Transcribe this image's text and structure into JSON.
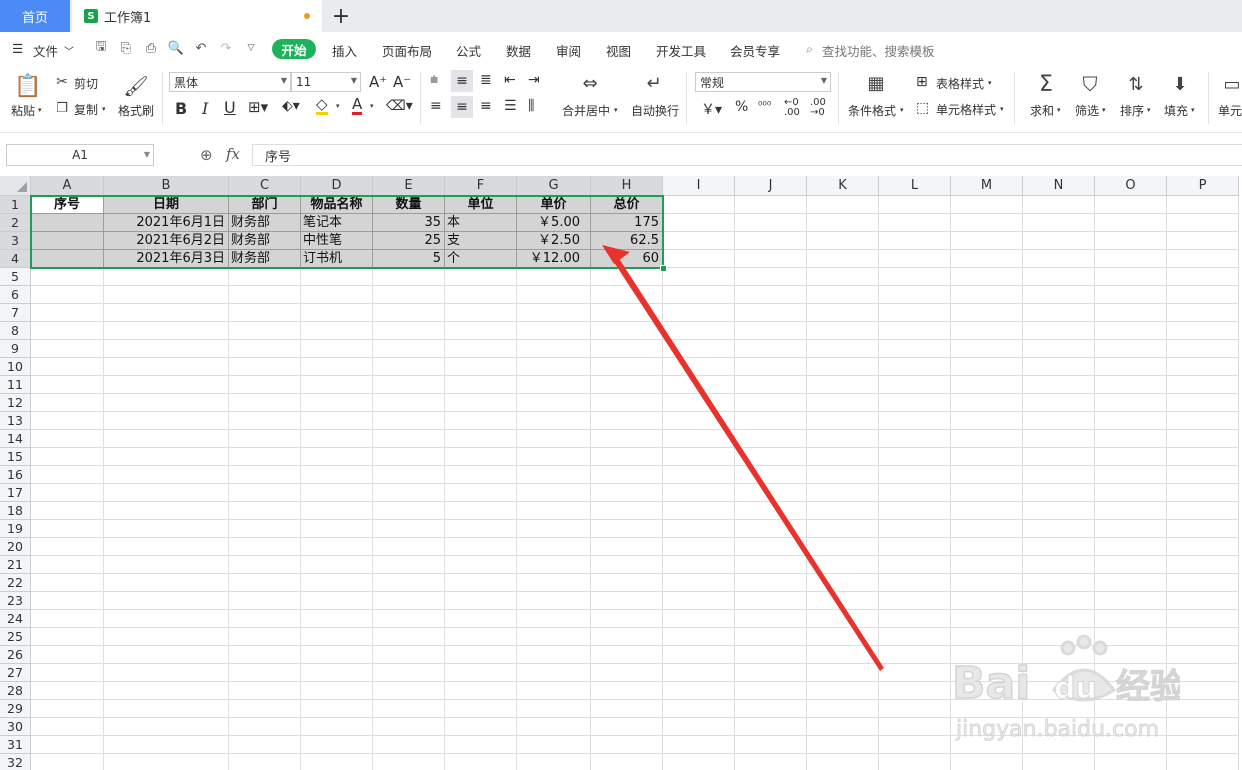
{
  "tabs": {
    "home": "首页",
    "doc": "工作簿1",
    "doc_icon": "S",
    "new_tab": "+"
  },
  "menu": {
    "file": "文件",
    "items": [
      "开始",
      "插入",
      "页面布局",
      "公式",
      "数据",
      "审阅",
      "视图",
      "开发工具",
      "会员专享"
    ],
    "search": "查找功能、搜索模板"
  },
  "ribbon": {
    "paste": "粘贴",
    "cut": "剪切",
    "copy": "复制",
    "format_painter": "格式刷",
    "font": "黑体",
    "size": "11",
    "merge": "合并居中",
    "wrap": "自动换行",
    "number_format": "常规",
    "cond_format": "条件格式",
    "table_style": "表格样式",
    "cell_style": "单元格样式",
    "sum": "求和",
    "filter": "筛选",
    "sort": "排序",
    "fill": "填充",
    "cell": "单元"
  },
  "formula_bar": {
    "name_box": "A1",
    "fx": "fx",
    "content": "序号"
  },
  "columns": [
    "A",
    "B",
    "C",
    "D",
    "E",
    "F",
    "G",
    "H",
    "I",
    "J",
    "K",
    "L",
    "M",
    "N",
    "O",
    "P"
  ],
  "rows": [
    "1",
    "2",
    "3",
    "4",
    "5",
    "6",
    "7",
    "8",
    "9",
    "10",
    "11",
    "12",
    "13",
    "14",
    "15",
    "16",
    "17",
    "18",
    "19",
    "20",
    "21",
    "22",
    "23",
    "24",
    "25",
    "26",
    "27",
    "28",
    "29",
    "30",
    "31",
    "32"
  ],
  "table": {
    "header": [
      "序号",
      "日期",
      "部门",
      "物品名称",
      "数量",
      "单位",
      "单价",
      "总价"
    ],
    "rows": [
      [
        "",
        "2021年6月1日",
        "财务部",
        "笔记本",
        "35",
        "本",
        "￥5.00",
        "175"
      ],
      [
        "",
        "2021年6月2日",
        "财务部",
        "中性笔",
        "25",
        "支",
        "￥2.50",
        "62.5"
      ],
      [
        "",
        "2021年6月3日",
        "财务部",
        "订书机",
        "5",
        "个",
        "￥12.00",
        "60"
      ]
    ]
  },
  "colors": {
    "accent_green": "#1fb25c",
    "selection_border": "#1f9d55",
    "arrow": "#e8322b",
    "home_tab": "#4c8bf5"
  }
}
